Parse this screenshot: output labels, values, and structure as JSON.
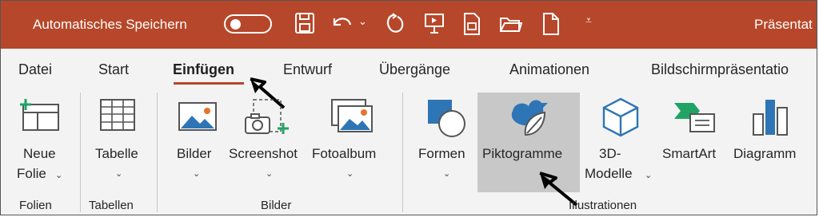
{
  "titlebar": {
    "autosave_label": "Automatisches Speichern",
    "autosave_state": "off",
    "doc_title": "Präsentat",
    "bg_color": "#b7472a",
    "icons": [
      "save-icon",
      "undo-icon",
      "undo-dropdown-icon",
      "redo-icon",
      "present-from-beginning-icon",
      "print-preview-icon",
      "open-folder-icon",
      "new-file-icon",
      "customize-qat-icon"
    ]
  },
  "tabs": [
    "Datei",
    "Start",
    "Einfügen",
    "Entwurf",
    "Übergänge",
    "Animationen",
    "Bildschirmpräsentatio"
  ],
  "active_tab": "Einfügen",
  "buttons": {
    "neue_folie_1": "Neue",
    "neue_folie_2": "Folie",
    "tabelle": "Tabelle",
    "bilder": "Bilder",
    "screenshot": "Screenshot",
    "fotoalbum": "Fotoalbum",
    "formen": "Formen",
    "piktogramme": "Piktogramme",
    "modelle_1": "3D-",
    "modelle_2": "Modelle",
    "smartart": "SmartArt",
    "diagramm": "Diagramm"
  },
  "groups": {
    "folien": "Folien",
    "tabellen": "Tabellen",
    "bilder": "Bilder",
    "illustrationen": "Illustrationen"
  },
  "annotations": [
    "pointer-arrow-icon (Einfügen)",
    "pointer-arrow-icon (Piktogramme)"
  ],
  "colors": {
    "accent": "#b7472a",
    "icon_blue": "#2e75b6",
    "icon_green": "#21a366",
    "highlight": "#c8c8c8"
  }
}
